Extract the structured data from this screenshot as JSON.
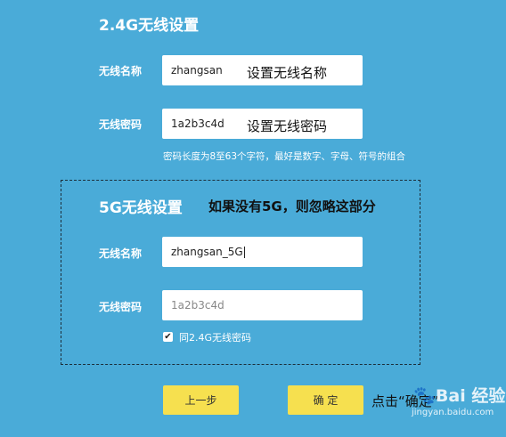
{
  "section_24g": {
    "title": "2.4G无线设置",
    "name_label": "无线名称",
    "name_value": "zhangsan",
    "name_annotation": "设置无线名称",
    "password_label": "无线密码",
    "password_value": "1a2b3c4d",
    "password_annotation": "设置无线密码",
    "password_hint": "密码长度为8至63个字符，最好是数字、字母、符号的组合"
  },
  "section_5g": {
    "title": "5G无线设置",
    "annotation": "如果没有5G，则忽略这部分",
    "name_label": "无线名称",
    "name_value": "zhangsan_5G",
    "password_label": "无线密码",
    "password_placeholder": "1a2b3c4d",
    "same_password_label": "同2.4G无线密码",
    "same_password_checked": true
  },
  "buttons": {
    "prev_label": "上一步",
    "confirm_label": "确 定"
  },
  "footer_annotation": "点击“确定”",
  "watermark": {
    "text": "Bai 经验",
    "url": "jingyan.baidu.com"
  }
}
